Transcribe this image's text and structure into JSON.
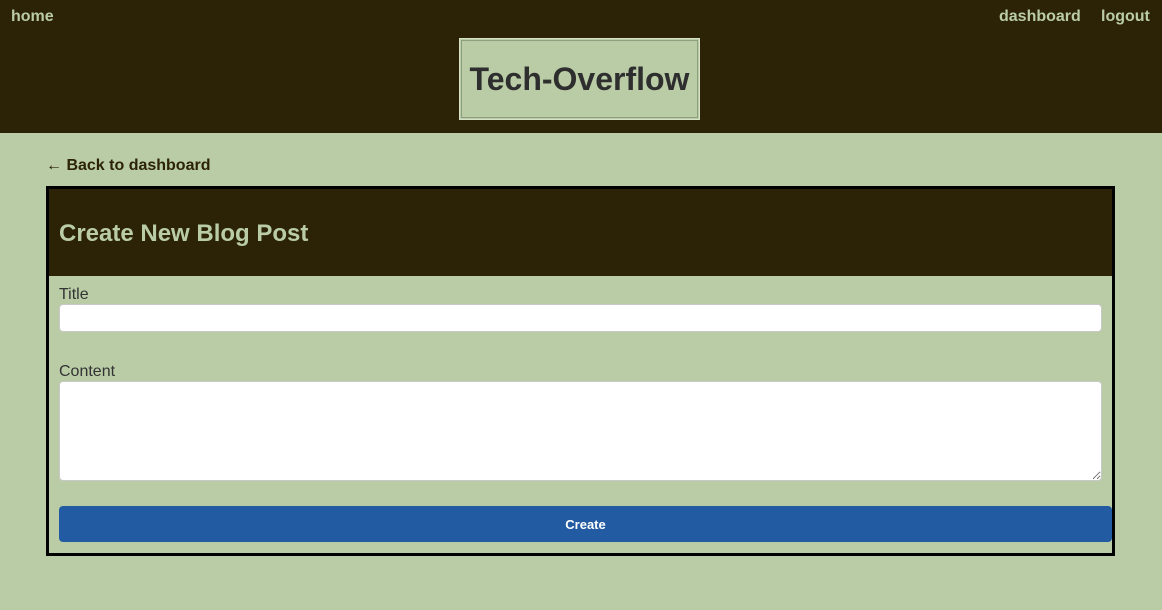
{
  "nav": {
    "home_label": "home",
    "dashboard_label": "dashboard",
    "logout_label": "logout"
  },
  "brand": {
    "title": "Tech-Overflow"
  },
  "back_link": {
    "label": "← Back to dashboard"
  },
  "form": {
    "heading": "Create New Blog Post",
    "title_label": "Title",
    "title_value": "",
    "content_label": "Content",
    "content_value": "",
    "submit_label": "Create"
  },
  "colors": {
    "header_bg": "#2c2307",
    "page_bg": "#b9cca6",
    "button_bg": "#225ba2",
    "card_border": "#000000"
  }
}
